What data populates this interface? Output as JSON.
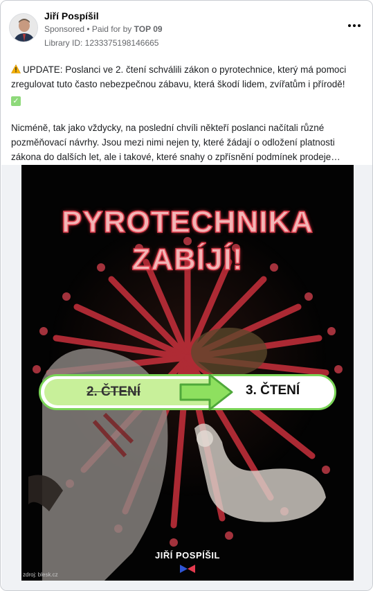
{
  "post": {
    "author": "Jiří Pospíšil",
    "sponsored_label": "Sponsored",
    "separator": " • ",
    "paid_for_prefix": "Paid for by ",
    "paid_for_by": "TOP 09",
    "library_id": "Library ID: 1233375198146665",
    "paragraph_1": "UPDATE: Poslanci ve 2. čtení schválili zákon o pyrotechnice, který má pomoci zregulovat tuto často nebezpečnou zábavu, která škodí lidem, zvířatům i přírodě!",
    "paragraph_2": "Nicméně, tak jako vždycky, na poslední chvíli někteří poslanci načítali různé pozměňovací návrhy. Jsou mezi nimi nejen ty, které žádají o odložení platnosti zákona do dalších let, ale i takové, které snahy o zpřísnění podmínek prodeje…"
  },
  "creative": {
    "headline_line_1": "PYROTECHNIKA",
    "headline_line_2": "ZABÍJÍ!",
    "step_from": "2. ČTENÍ",
    "step_to": "3. ČTENÍ",
    "brand_name": "JIŘÍ POSPÍŠIL",
    "source_credit": "zdroj: blesk.cz"
  },
  "icons": {
    "warning": "warning-icon",
    "check": "check-mark-icon",
    "more": "more-options-icon",
    "arrow": "right-arrow-icon",
    "logo": "party-logo-icon"
  },
  "colors": {
    "accent_green": "#7ad457",
    "headline_red": "#e0404f",
    "firework_red": "#c8303c"
  }
}
